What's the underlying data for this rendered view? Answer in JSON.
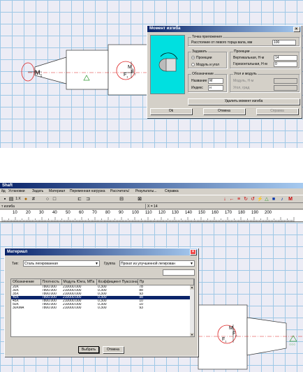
{
  "top_screen": {
    "shaft_labels": {
      "moment": "M",
      "moment_sub": "1",
      "force1": "F",
      "force1_sub": "1",
      "force2": "F",
      "force2_sub": "2",
      "moment2": "M",
      "moment2_sub": "1"
    },
    "dialog": {
      "title": "Момент изгиба",
      "close": "×",
      "group_apply_title": "Точка приложения",
      "distance_label": "Расстояние от левого торца вала, мм",
      "distance_value": "100",
      "group_set_title": "Задавать",
      "radio_projections": "Проекции",
      "radio_modulus": "Модуль и угол",
      "group_proj_title": "Проекции",
      "vertical_label": "Вертикальная, Н·м",
      "vertical_value": "14",
      "horizontal_label": "Горизонтальная, Н·м",
      "horizontal_value": "0",
      "group_desig_title": "Обозначение",
      "name_label": "Название",
      "name_value": "M",
      "index_label": "Индекс",
      "index_value": "н",
      "group_angle_title": "Угол и модуль",
      "modulus_label": "Модуль, Н·м",
      "angle_label": "Угол, град",
      "delete_button": "Удалить момент изгиба",
      "ok_button": "Ok",
      "cancel_button": "Отмена",
      "help_button": "Справка"
    }
  },
  "bottom_screen": {
    "app_title": "Shaft",
    "menu": [
      "йд",
      "Установки",
      "Задать",
      "Материал",
      "Переменная нагрузка",
      "Рассчитать!",
      "Результаты...",
      "Справка"
    ],
    "status_left": "т изгиба",
    "status_coord": "X = 14",
    "ruler_ticks": [
      "10",
      "20",
      "30",
      "40",
      "50",
      "60",
      "70",
      "80",
      "90",
      "100",
      "110",
      "120",
      "130",
      "140",
      "150",
      "160",
      "170",
      "180",
      "190",
      "200"
    ],
    "shaft_labels": {
      "moment": "M",
      "moment_sub": "1",
      "force1": "F",
      "force1_sub": "1",
      "force2": "F",
      "force2_sub": "2",
      "moment2": "M",
      "moment2_sub": "1",
      "support": "○○○"
    },
    "dialog": {
      "title": "Материал",
      "close": "×",
      "type_label": "Тип:",
      "type_value": "Сталь легированная",
      "group_label": "Группа",
      "group_value": "Прокат из улучшенной легирован",
      "columns": [
        "Обозначение",
        "Плотность",
        "Модуль Юнга, МПа",
        "Коэффициент Пуассона",
        "Пр"
      ],
      "rows": [
        [
          "20Х",
          "7800.000",
          "210000.000",
          "0.300",
          "78"
        ],
        [
          "30Х",
          "7800.000",
          "210000.000",
          "0.300",
          "88"
        ],
        [
          "35Х",
          "7800.000",
          "210000.000",
          "0.300",
          "93"
        ],
        [
          "40Х",
          "7800.000",
          "210000.000",
          "0.300",
          "98"
        ],
        [
          "45Х",
          "7800.000",
          "210000.000",
          "0.300",
          "10"
        ],
        [
          "50Х",
          "7800.000",
          "210000.000",
          "0.300",
          "10"
        ],
        [
          "30ХМА",
          "7800.000",
          "210000.000",
          "0.300",
          "93"
        ]
      ],
      "selected_row": 3,
      "select_button": "Выбрать",
      "cancel_button": "Отмена"
    }
  }
}
